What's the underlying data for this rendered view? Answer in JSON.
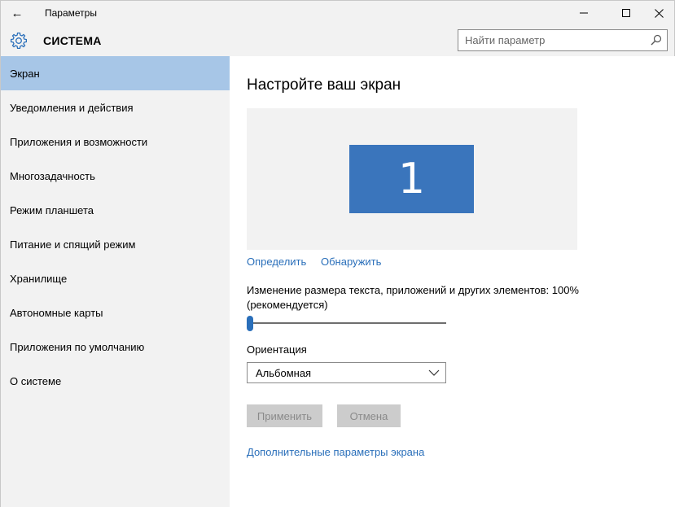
{
  "window": {
    "title": "Параметры",
    "back_glyph": "←",
    "minimize_glyph": "—",
    "maximize_glyph": "☐",
    "close_glyph": "✕"
  },
  "header": {
    "section_title": "СИСТЕМА",
    "search": {
      "placeholder": "Найти параметр",
      "value": ""
    }
  },
  "sidebar": {
    "items": [
      {
        "label": "Экран",
        "active": true
      },
      {
        "label": "Уведомления и действия"
      },
      {
        "label": "Приложения и возможности"
      },
      {
        "label": "Многозадачность"
      },
      {
        "label": "Режим планшета"
      },
      {
        "label": "Питание и спящий режим"
      },
      {
        "label": "Хранилище"
      },
      {
        "label": "Автономные карты"
      },
      {
        "label": "Приложения по умолчанию"
      },
      {
        "label": "О системе"
      }
    ]
  },
  "main": {
    "title": "Настройте ваш экран",
    "display_number": "1",
    "identify_link": "Определить",
    "detect_link": "Обнаружить",
    "scale_label": "Изменение размера текста, приложений и других элементов: 100% (рекомендуется)",
    "scale_value_percent": 0,
    "orientation_label": "Ориентация",
    "orientation_value": "Альбомная",
    "apply_button": "Применить",
    "cancel_button": "Отмена",
    "advanced_link": "Дополнительные параметры экрана"
  },
  "colors": {
    "accent": "#2a6fba",
    "active_item": "#a7c6e7",
    "monitor": "#3a75bc",
    "sidebar_bg": "#f2f2f2"
  },
  "icons": {
    "section": "gear-icon",
    "search": "search-icon",
    "select": "chevron-down-icon"
  }
}
